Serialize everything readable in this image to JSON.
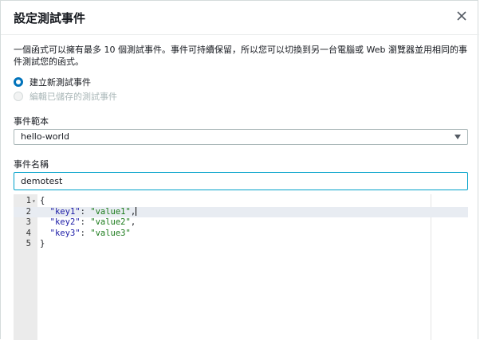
{
  "dialog": {
    "title": "設定測試事件",
    "description": "一個函式可以擁有最多 10 個測試事件。事件可持續保留，所以您可以切換到另一台電腦或 Web 瀏覽器並用相同的事件測試您的函式。",
    "options": [
      {
        "label": "建立新測試事件",
        "selected": true,
        "enabled": true
      },
      {
        "label": "編輯已儲存的測試事件",
        "selected": false,
        "enabled": false
      }
    ],
    "template_label": "事件範本",
    "template_value": "hello-world",
    "name_label": "事件名稱",
    "name_value": "demotest",
    "editor": {
      "lines": [
        {
          "num": "1",
          "fold": true,
          "parts": [
            {
              "t": "{",
              "c": ""
            }
          ]
        },
        {
          "num": "2",
          "fold": false,
          "active": true,
          "parts": [
            {
              "t": "  ",
              "c": ""
            },
            {
              "t": "\"key1\"",
              "c": "str"
            },
            {
              "t": ": ",
              "c": ""
            },
            {
              "t": "\"value1\"",
              "c": "val"
            },
            {
              "t": ",",
              "c": ""
            }
          ]
        },
        {
          "num": "3",
          "fold": false,
          "parts": [
            {
              "t": "  ",
              "c": ""
            },
            {
              "t": "\"key2\"",
              "c": "str"
            },
            {
              "t": ": ",
              "c": ""
            },
            {
              "t": "\"value2\"",
              "c": "val"
            },
            {
              "t": ",",
              "c": ""
            }
          ]
        },
        {
          "num": "4",
          "fold": false,
          "parts": [
            {
              "t": "  ",
              "c": ""
            },
            {
              "t": "\"key3\"",
              "c": "str"
            },
            {
              "t": ": ",
              "c": ""
            },
            {
              "t": "\"value3\"",
              "c": "val"
            }
          ]
        },
        {
          "num": "5",
          "fold": false,
          "parts": [
            {
              "t": "}",
              "c": ""
            }
          ]
        }
      ]
    }
  }
}
